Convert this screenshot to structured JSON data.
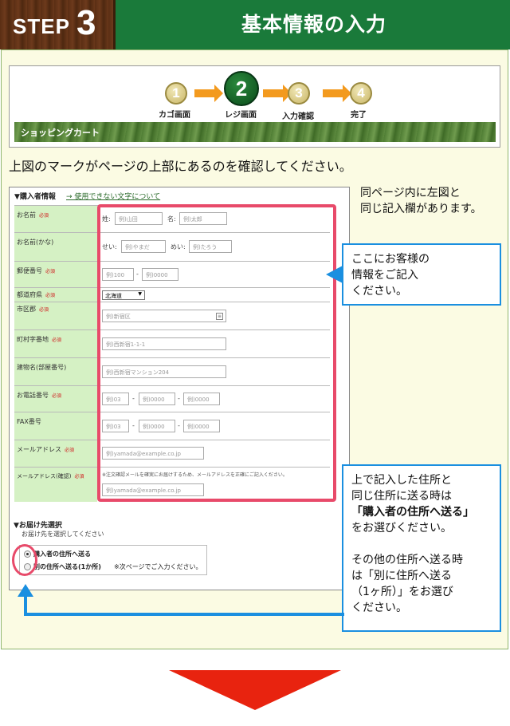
{
  "header": {
    "step_word": "STEP",
    "step_number": "3",
    "title": "基本情報の入力"
  },
  "progress": {
    "steps": [
      {
        "number": "1",
        "label": "カゴ画面"
      },
      {
        "number": "2",
        "label": "レジ画面"
      },
      {
        "number": "3",
        "label": "入力確認"
      },
      {
        "number": "4",
        "label": "完了"
      }
    ],
    "cart_label": "ショッピングカート"
  },
  "instruction": "上図のマークがページの上部にあるのを確認してください。",
  "form": {
    "heading": "▼購入者情報",
    "heading_link": "→ 使用できない文字について",
    "required_mark": "必須",
    "rows": {
      "name": {
        "label": "お名前",
        "sei_label": "姓:",
        "sei_placeholder": "例)山田",
        "mei_label": "名:",
        "mei_placeholder": "例)太郎"
      },
      "kana": {
        "label": "お名前(かな)",
        "sei_label": "せい:",
        "sei_placeholder": "例)やまだ",
        "mei_label": "めい:",
        "mei_placeholder": "例)たろう"
      },
      "zip": {
        "label": "郵便番号",
        "part1": "例)100",
        "dash": "-",
        "part2": "例)0000"
      },
      "pref": {
        "label": "都道府県",
        "value": "北海道"
      },
      "city": {
        "label": "市区郡",
        "placeholder": "例)新宿区"
      },
      "town": {
        "label": "町村字番地",
        "placeholder": "例)西新宿1-1-1"
      },
      "building": {
        "label": "建物名(部屋番号)",
        "placeholder": "例)西新宿マンション204"
      },
      "tel": {
        "label": "お電話番号",
        "p1": "例)03",
        "p2": "例)0000",
        "p3": "例)0000",
        "dash": "-"
      },
      "fax": {
        "label": "FAX番号",
        "p1": "例)03",
        "p2": "例)0000",
        "p3": "例)0000",
        "dash": "-"
      },
      "email": {
        "label": "メールアドレス",
        "placeholder": "例)yamada@example.co.jp"
      },
      "email_confirm": {
        "label": "メールアドレス(確認)",
        "note": "※注文確認メールを確実にお届けするため、メールアドレスを正確にご記入ください。",
        "placeholder": "例)yamada@example.co.jp"
      }
    }
  },
  "delivery": {
    "title": "▼お届け先選択",
    "subtitle": "お届け先を選択してください",
    "option1": "購入者の住所へ送る",
    "option2": "別の住所へ送る(1か所)",
    "option2_note": "※次ページでご入力ください。"
  },
  "notes": {
    "side": [
      "同ページ内に左図と",
      "同じ記入欄があります。"
    ],
    "callout1": [
      "ここにお客様の",
      "情報をご記入",
      "ください。"
    ],
    "callout2_lines": [
      "上で記入した住所と",
      "同じ住所に送る時は"
    ],
    "callout2_bold": "「購入者の住所へ送る」",
    "callout2_after": "をお選びください。",
    "callout2_more": [
      "その他の住所へ送る時",
      "は「別に住所へ送る",
      "（1ヶ所）」をお選び",
      "ください。"
    ]
  },
  "colors": {
    "header_green": "#1a7a3a",
    "accent_red": "#e84a6a",
    "callout_blue": "#1a8fe0",
    "arrow_red": "#e8230f"
  }
}
